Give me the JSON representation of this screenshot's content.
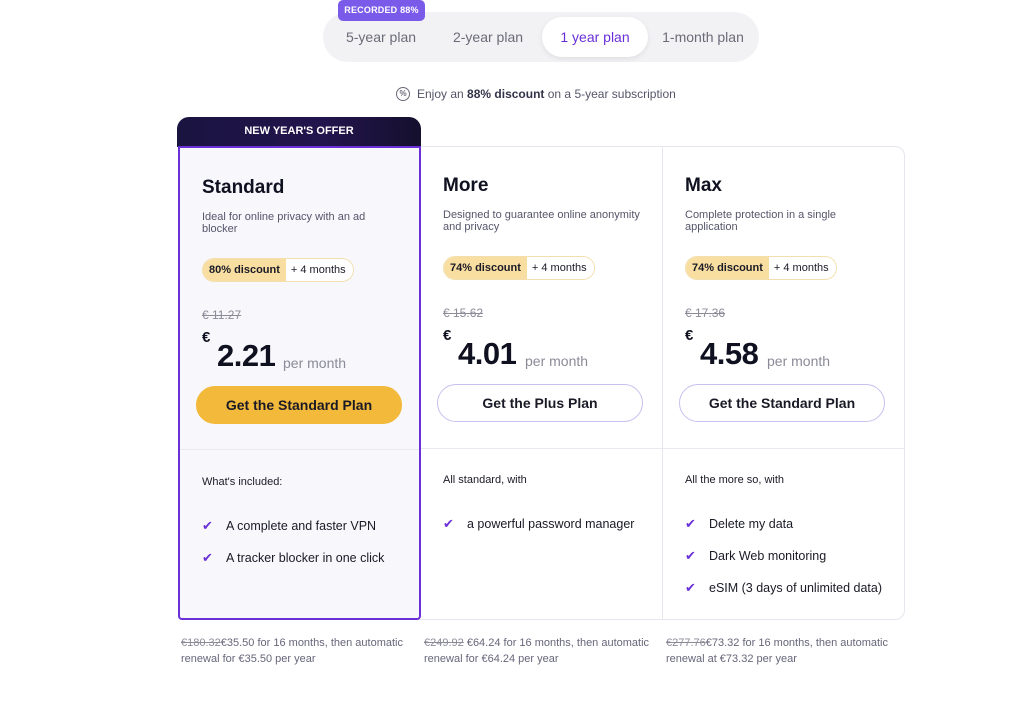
{
  "tabs": {
    "badge": "RECORDED 88%",
    "items": [
      {
        "label": "5-year plan"
      },
      {
        "label": "2-year plan"
      },
      {
        "label": "1 year plan"
      },
      {
        "label": "1-month plan"
      }
    ],
    "active": "1 year plan"
  },
  "note": {
    "prefix": "Enjoy an",
    "highlight": "88% discount",
    "suffix": "on a 5-year subscription"
  },
  "offer_banner": "NEW YEAR'S OFFER",
  "plans": [
    {
      "name": "Standard",
      "description": "Ideal for online privacy with an ad blocker",
      "discount": "80% discount",
      "extra": "+ 4 months",
      "old_price": "€ 11.27",
      "currency": "€",
      "price": "2.21",
      "per": "per month",
      "cta": "Get the Standard Plan",
      "included_title": "What's included:",
      "features": [
        "A complete and faster VPN",
        "A tracker blocker in one click"
      ],
      "renewal_old": "€180.32",
      "renewal_text": "€35.50 for 16 months, then automatic renewal for €35.50 per year"
    },
    {
      "name": "More",
      "description": "Designed to guarantee online anonymity and privacy",
      "discount": "74% discount",
      "extra": "+ 4 months",
      "old_price": "€ 15.62",
      "currency": "€",
      "price": "4.01",
      "per": "per month",
      "cta": "Get the Plus Plan",
      "included_title": "All standard, with",
      "features": [
        "a powerful password manager"
      ],
      "renewal_old": "€249.92",
      "renewal_text": " €64.24 for 16 months, then automatic renewal for €64.24 per year"
    },
    {
      "name": "Max",
      "description": "Complete protection in a single application",
      "discount": "74% discount",
      "extra": "+ 4 months",
      "old_price": "€ 17.36",
      "currency": "€",
      "price": "4.58",
      "per": "per month",
      "cta": "Get the Standard Plan",
      "included_title": "All the more so, with",
      "features": [
        "Delete my data",
        "Dark Web monitoring",
        "eSIM (3 days of unlimited data)"
      ],
      "renewal_old": "€277.76",
      "renewal_text": "€73.32 for 16 months, then automatic renewal at €73.32 per year"
    }
  ],
  "colors": {
    "accent": "#6a2fd8",
    "cta_primary": "#f2b93b",
    "badge_bg": "#f8dea0",
    "banner_bg": "#1a1440"
  }
}
